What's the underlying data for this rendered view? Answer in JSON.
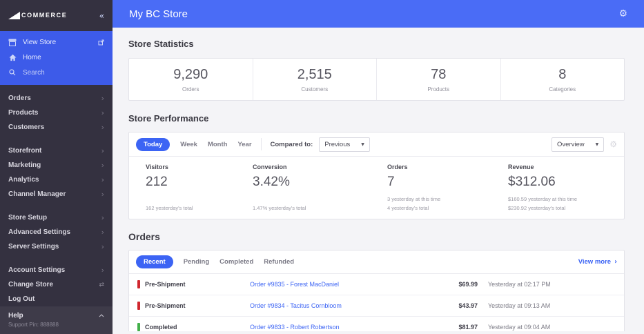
{
  "sidebar": {
    "brand": "COMMERCE",
    "collapse_icon": "«",
    "quick_items": [
      {
        "label": "View Store"
      },
      {
        "label": "Home"
      },
      {
        "label": "Search"
      }
    ],
    "groups": [
      {
        "items": [
          {
            "label": "Orders"
          },
          {
            "label": "Products"
          },
          {
            "label": "Customers"
          }
        ]
      },
      {
        "items": [
          {
            "label": "Storefront"
          },
          {
            "label": "Marketing"
          },
          {
            "label": "Analytics"
          },
          {
            "label": "Channel Manager"
          }
        ]
      },
      {
        "items": [
          {
            "label": "Store Setup"
          },
          {
            "label": "Advanced Settings"
          },
          {
            "label": "Server Settings"
          }
        ]
      },
      {
        "items": [
          {
            "label": "Account Settings"
          },
          {
            "label": "Change Store"
          },
          {
            "label": "Log Out"
          }
        ]
      }
    ],
    "help": {
      "label": "Help",
      "pin": "Support Pin: 888888"
    }
  },
  "header": {
    "title": "My BC Store"
  },
  "stats": {
    "title": "Store Statistics",
    "cards": [
      {
        "value": "9,290",
        "label": "Orders"
      },
      {
        "value": "2,515",
        "label": "Customers"
      },
      {
        "value": "78",
        "label": "Products"
      },
      {
        "value": "8",
        "label": "Categories"
      }
    ]
  },
  "performance": {
    "title": "Store Performance",
    "range_tabs": [
      {
        "label": "Today"
      },
      {
        "label": "Week"
      },
      {
        "label": "Month"
      },
      {
        "label": "Year"
      }
    ],
    "compared_label": "Compared to:",
    "compared_value": "Previous",
    "view_value": "Overview",
    "metrics": [
      {
        "label": "Visitors",
        "value": "212",
        "sub_now": "",
        "sub_total": "162 yesterday's total"
      },
      {
        "label": "Conversion",
        "value": "3.42%",
        "sub_now": "",
        "sub_total": "1.47% yesterday's total"
      },
      {
        "label": "Orders",
        "value": "7",
        "sub_now": "3 yesterday at this time",
        "sub_total": "4 yesterday's total"
      },
      {
        "label": "Revenue",
        "value": "$312.06",
        "sub_now": "$160.59 yesterday at this time",
        "sub_total": "$230.92 yesterday's total"
      }
    ]
  },
  "orders": {
    "title": "Orders",
    "tabs": [
      {
        "label": "Recent"
      },
      {
        "label": "Pending"
      },
      {
        "label": "Completed"
      },
      {
        "label": "Refunded"
      }
    ],
    "view_more": "View more",
    "rows": [
      {
        "status": "Pre-Shipment",
        "status_color": "#d0272e",
        "link": "Order #9835 - Forest MacDaniel",
        "price": "$69.99",
        "time": "Yesterday at 02:17 PM"
      },
      {
        "status": "Pre-Shipment",
        "status_color": "#d0272e",
        "link": "Order #9834 - Tacitus Cornbloom",
        "price": "$43.97",
        "time": "Yesterday at 09:13 AM"
      },
      {
        "status": "Completed",
        "status_color": "#43b04a",
        "link": "Order #9833 - Robert Robertson",
        "price": "$81.97",
        "time": "Yesterday at 09:04 AM"
      }
    ]
  },
  "colors": {
    "accent": "#3c64f4",
    "header_blue": "#4a6cf6",
    "quick_panel_blue": "#3d5be9",
    "sidebar_dark": "#343140",
    "danger": "#d0272e",
    "success": "#43b04a"
  }
}
